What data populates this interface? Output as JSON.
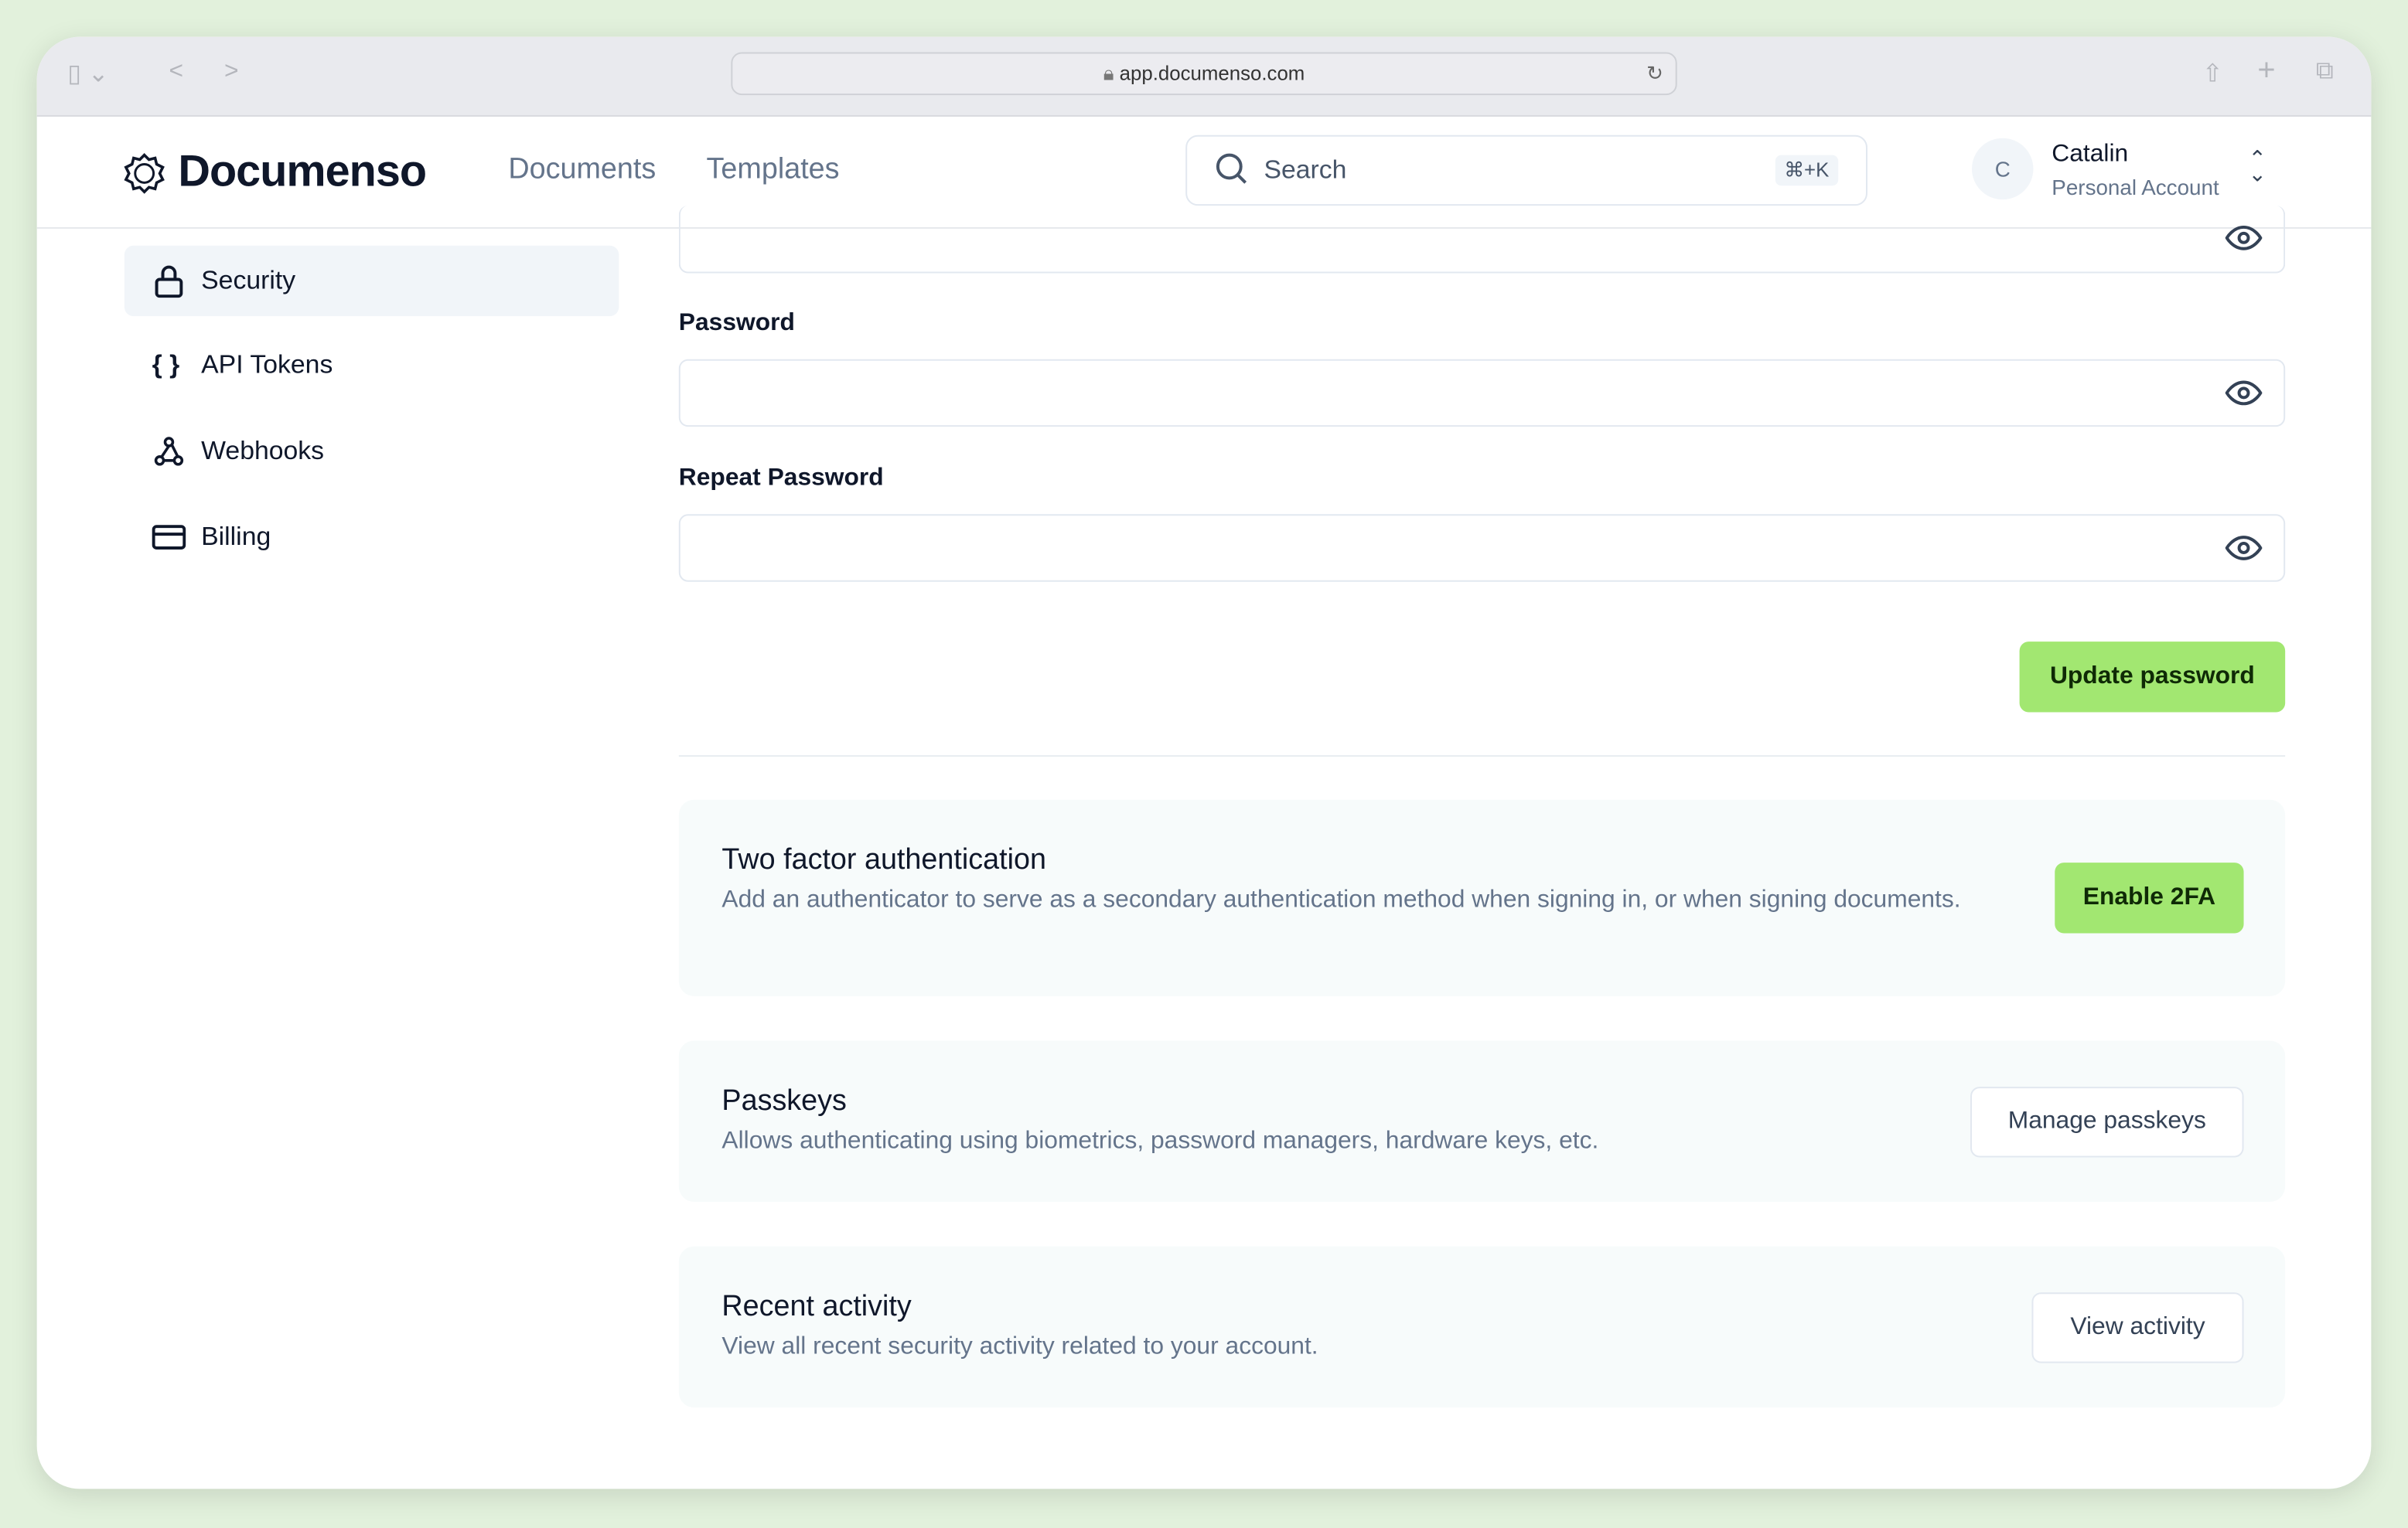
{
  "browser": {
    "url": "app.documenso.com"
  },
  "header": {
    "brand": "Documenso",
    "nav": [
      "Documents",
      "Templates"
    ],
    "search_label": "Search",
    "search_shortcut": "⌘+K",
    "user": {
      "initial": "C",
      "name": "Catalin",
      "account": "Personal Account"
    }
  },
  "sidebar": {
    "items": [
      {
        "label": "Security",
        "icon": "lock-icon",
        "active": true
      },
      {
        "label": "API Tokens",
        "icon": "braces-icon"
      },
      {
        "label": "Webhooks",
        "icon": "webhook-icon"
      },
      {
        "label": "Billing",
        "icon": "credit-card-icon"
      }
    ]
  },
  "password_form": {
    "password_label": "Password",
    "repeat_label": "Repeat Password",
    "submit": "Update password"
  },
  "sections": [
    {
      "title": "Two factor authentication",
      "description": "Add an authenticator to serve as a secondary authentication method when signing in, or when signing documents.",
      "button": "Enable 2FA"
    },
    {
      "title": "Passkeys",
      "description": "Allows authenticating using biometrics, password managers, hardware keys, etc.",
      "button": "Manage passkeys"
    },
    {
      "title": "Recent activity",
      "description": "View all recent security activity related to your account.",
      "button": "View activity"
    }
  ],
  "colors": {
    "accent": "#a2e771",
    "background": "#e2f1dc"
  }
}
